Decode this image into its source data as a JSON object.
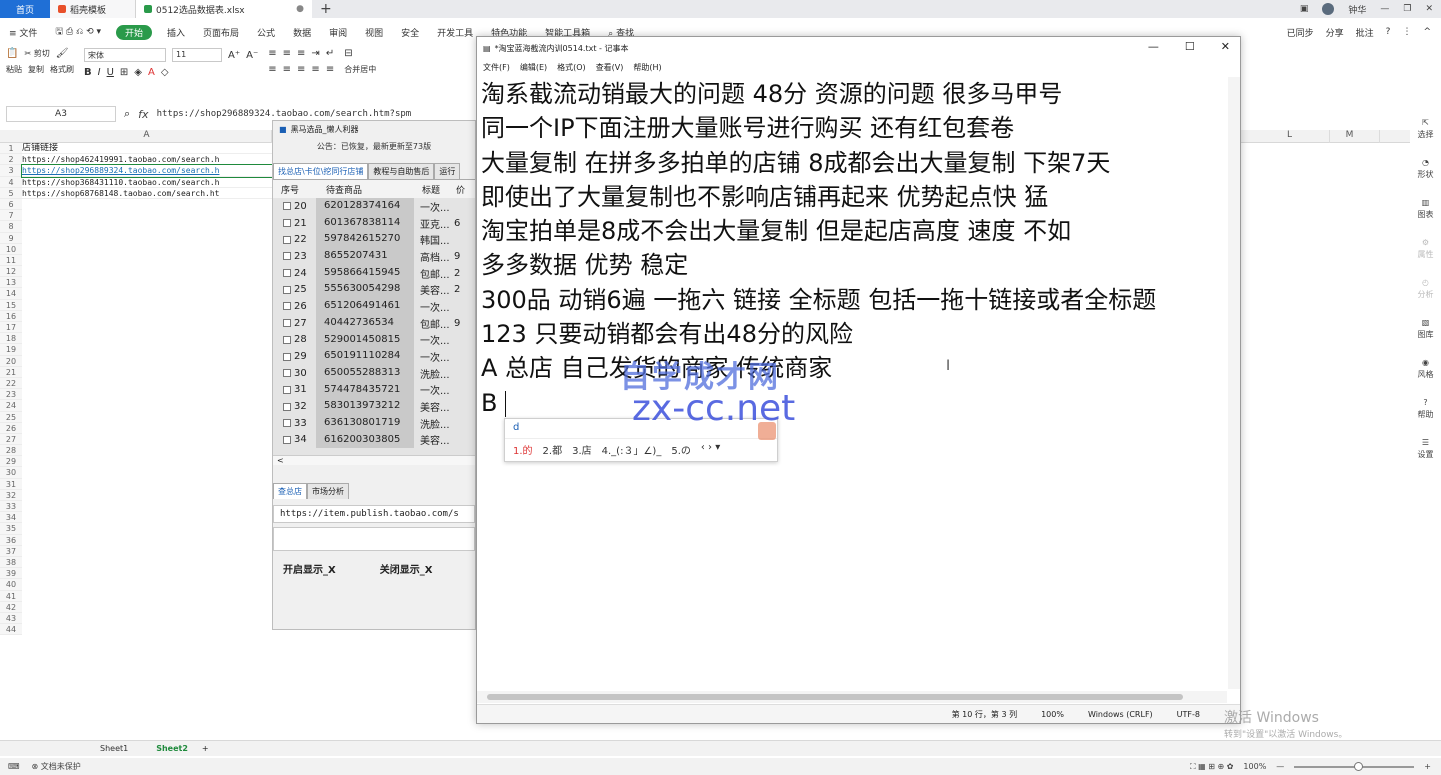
{
  "tabbar": {
    "home": "首页",
    "tab1": "稻壳模板",
    "tab2": "0512选品数据表.xlsx",
    "plus": "+",
    "user": "钟华"
  },
  "menu": {
    "file": "文件",
    "items": [
      "插入",
      "页面布局",
      "公式",
      "数据",
      "审阅",
      "视图",
      "安全",
      "开发工具",
      "特色功能",
      "智能工具箱"
    ],
    "start": "开始",
    "search": "查找",
    "right": [
      "已同步",
      "分享",
      "批注"
    ]
  },
  "ribbon": {
    "paste": "粘贴",
    "cut": "剪切",
    "copy": "复制",
    "format_painter": "格式刷",
    "font": "宋体",
    "size": "11",
    "merge": "合并居中"
  },
  "formula": {
    "cell": "A3",
    "fx": "fx",
    "value": "https://shop296889324.taobao.com/search.htm?spm"
  },
  "sheet": {
    "columns": [
      "A",
      "L",
      "M"
    ],
    "rows": [
      "1",
      "2",
      "3",
      "4",
      "5",
      "6",
      "7",
      "8",
      "9",
      "10",
      "11",
      "12",
      "13",
      "14",
      "15",
      "16",
      "17",
      "18",
      "19",
      "20",
      "21",
      "22",
      "23",
      "24",
      "25",
      "26",
      "27",
      "28",
      "29",
      "30",
      "31",
      "32",
      "33",
      "34",
      "35",
      "36",
      "37",
      "38",
      "39",
      "40",
      "41",
      "42",
      "43",
      "44"
    ],
    "cells": [
      "店铺链接",
      "https://shop462419991.taobao.com/search.h",
      "https://shop296889324.taobao.com/search.h",
      "https://shop368431110.taobao.com/search.h",
      "https://shop68768148.taobao.com/search.ht"
    ],
    "tabs": [
      "Sheet1",
      "Sheet2"
    ]
  },
  "status": {
    "protect": "文档未保护",
    "zoom": "100%"
  },
  "sidepanel": [
    "选择",
    "形状",
    "图表",
    "属性",
    "分析",
    "图库",
    "风格",
    "帮助",
    "设置"
  ],
  "tool": {
    "title": "黑马选品_懒人利器",
    "notice": "公告：已恢复，最新更新至73版",
    "tabs": [
      "找总店\\卡位\\挖同行店铺",
      "教程与自助售后",
      "运行"
    ],
    "headers": [
      "序号",
      "待查商品",
      "标题",
      "价"
    ],
    "rows": [
      {
        "n": "20",
        "id": "620128374164",
        "t": "一次...",
        "p": ""
      },
      {
        "n": "21",
        "id": "601367838114",
        "t": "亚克...",
        "p": "6"
      },
      {
        "n": "22",
        "id": "597842615270",
        "t": "韩国...",
        "p": ""
      },
      {
        "n": "23",
        "id": "8655207431",
        "t": "高档...",
        "p": "9"
      },
      {
        "n": "24",
        "id": "595866415945",
        "t": "包邮...",
        "p": "2"
      },
      {
        "n": "25",
        "id": "555630054298",
        "t": "美容...",
        "p": "2"
      },
      {
        "n": "26",
        "id": "651206491461",
        "t": "一次...",
        "p": ""
      },
      {
        "n": "27",
        "id": "40442736534",
        "t": "包邮...",
        "p": "9"
      },
      {
        "n": "28",
        "id": "529001450815",
        "t": "一次...",
        "p": ""
      },
      {
        "n": "29",
        "id": "650191110284",
        "t": "一次...",
        "p": ""
      },
      {
        "n": "30",
        "id": "650055288313",
        "t": "洗脸...",
        "p": ""
      },
      {
        "n": "31",
        "id": "574478435721",
        "t": "一次...",
        "p": ""
      },
      {
        "n": "32",
        "id": "583013973212",
        "t": "美容...",
        "p": ""
      },
      {
        "n": "33",
        "id": "636130801719",
        "t": "洗脸...",
        "p": ""
      },
      {
        "n": "34",
        "id": "616200303805",
        "t": "美容...",
        "p": ""
      }
    ],
    "tabs2": [
      "查总店",
      "市场分析"
    ],
    "url": "https://item.publish.taobao.com/s",
    "btn_open": "开启显示_X",
    "btn_close": "关闭显示_X"
  },
  "notepad": {
    "title": "*淘宝蓝海截流内训0514.txt - 记事本",
    "menu": [
      "文件(F)",
      "编辑(E)",
      "格式(O)",
      "查看(V)",
      "帮助(H)"
    ],
    "lines": [
      "淘系截流动销最大的问题  48分 资源的问题 很多马甲号",
      "同一个IP下面注册大量账号进行购买  还有红包套卷",
      "大量复制  在拼多多拍单的店铺 8成都会出大量复制  下架7天",
      "即使出了大量复制也不影响店铺再起来    优势起点快 猛",
      "淘宝拍单是8成不会出大量复制    但是起店高度  速度 不如",
      "多多数据     优势 稳定",
      "300品 动销6遍  一拖六 链接 全标题  包括一拖十链接或者全标题",
      "123  只要动销都会有出48分的风险",
      "A 总店 自己发货的商家  传统商家",
      "B"
    ],
    "status": {
      "pos": "第 10 行，第 3 列",
      "zoom": "100%",
      "eol": "Windows (CRLF)",
      "enc": "UTF-8"
    }
  },
  "ime": {
    "comp": "d",
    "cands": [
      "1.的",
      "2.都",
      "3.店",
      "4._(:３」∠)_",
      "5.の"
    ]
  },
  "watermark": {
    "line1": "自学成才网",
    "line2": "zx-cc.net"
  },
  "activate": {
    "line1": "激活 Windows",
    "line2": "转到\"设置\"以激活 Windows。"
  }
}
